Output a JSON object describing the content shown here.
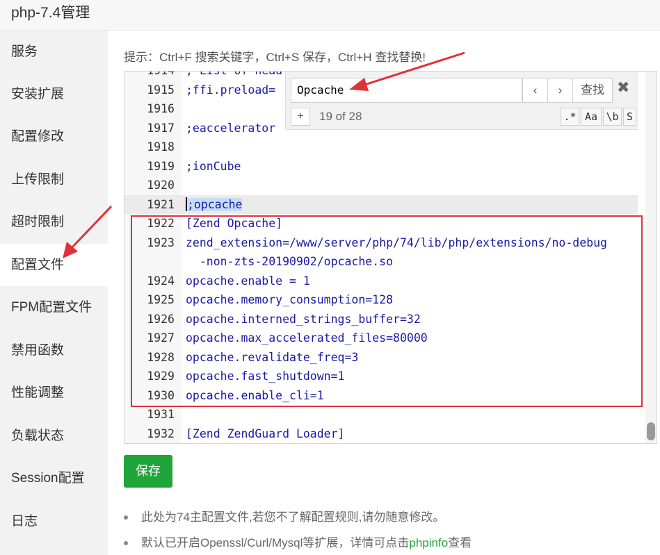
{
  "window": {
    "title": "php-7.4管理"
  },
  "sidebar": {
    "items": [
      {
        "label": "服务"
      },
      {
        "label": "安装扩展"
      },
      {
        "label": "配置修改"
      },
      {
        "label": "上传限制"
      },
      {
        "label": "超时限制"
      },
      {
        "label": "配置文件",
        "active": true
      },
      {
        "label": "FPM配置文件"
      },
      {
        "label": "禁用函数"
      },
      {
        "label": "性能调整"
      },
      {
        "label": "负载状态"
      },
      {
        "label": "Session配置"
      },
      {
        "label": "日志"
      }
    ]
  },
  "hint": "提示：Ctrl+F 搜索关键字，Ctrl+S 保存，Ctrl+H 查找替换!",
  "editor": {
    "top_partial": {
      "ln": "1914",
      "code": "; List of head"
    },
    "lines": [
      {
        "ln": "1915",
        "code": ";ffi.preload="
      },
      {
        "ln": "1916",
        "code": ""
      },
      {
        "ln": "1917",
        "code": ";eaccelerator"
      },
      {
        "ln": "1918",
        "code": ""
      },
      {
        "ln": "1919",
        "code": ";ionCube"
      },
      {
        "ln": "1920",
        "code": ""
      },
      {
        "ln": "1921",
        "code": ";opcache"
      },
      {
        "ln": "1922",
        "code": "[Zend Opcache]"
      },
      {
        "ln": "1923",
        "code": "zend_extension=/www/server/php/74/lib/php/extensions/no-debug"
      },
      {
        "ln": "",
        "code": "  -non-zts-20190902/opcache.so"
      },
      {
        "ln": "1924",
        "code": "opcache.enable = 1"
      },
      {
        "ln": "1925",
        "code": "opcache.memory_consumption=128"
      },
      {
        "ln": "1926",
        "code": "opcache.interned_strings_buffer=32"
      },
      {
        "ln": "1927",
        "code": "opcache.max_accelerated_files=80000"
      },
      {
        "ln": "1928",
        "code": "opcache.revalidate_freq=3"
      },
      {
        "ln": "1929",
        "code": "opcache.fast_shutdown=1"
      },
      {
        "ln": "1930",
        "code": "opcache.enable_cli=1"
      },
      {
        "ln": "1931",
        "code": ""
      },
      {
        "ln": "1932",
        "code": "[Zend ZendGuard Loader]"
      }
    ],
    "current_line": "1921"
  },
  "search": {
    "value": "Opcache",
    "prev": "‹",
    "next": "›",
    "find_label": "查找",
    "close": "✖",
    "add": "+",
    "count": "19 of 28",
    "options": [
      ".*",
      "Aa",
      "\\b",
      "S"
    ]
  },
  "save_label": "保存",
  "notes": [
    {
      "text": "此处为74主配置文件,若您不了解配置规则,请勿随意修改。"
    },
    {
      "pre": "默认已开启Openssl/Curl/Mysql等扩展，详情可点击",
      "link": "phpinfo",
      "post": "查看"
    }
  ],
  "colors": {
    "accent": "#20a53a",
    "annotation": "#e0313a",
    "code": "#1a1aa6"
  }
}
